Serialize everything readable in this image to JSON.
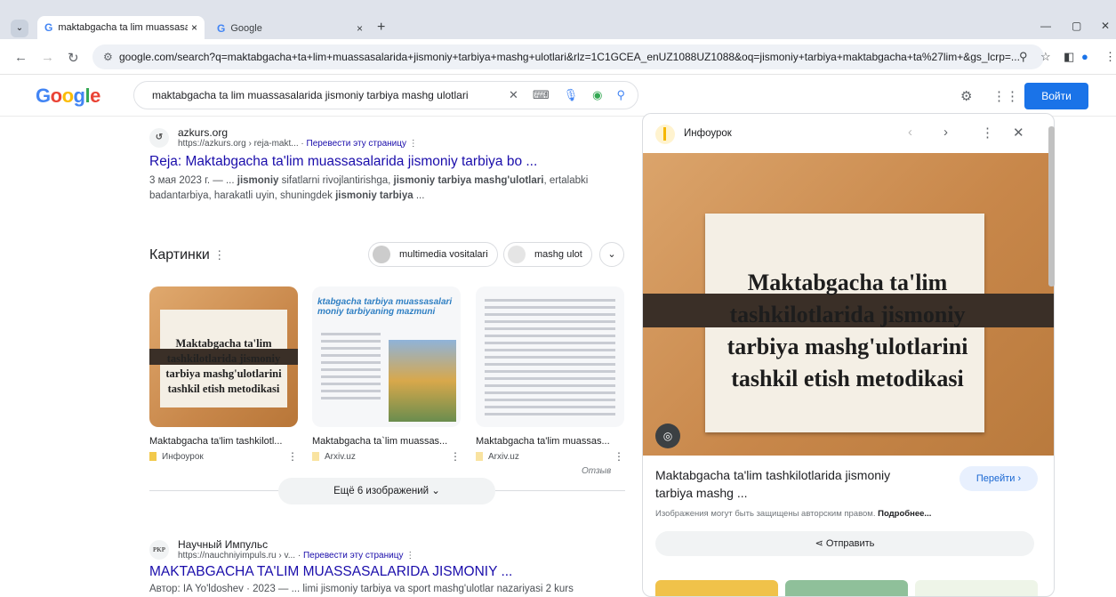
{
  "browser": {
    "tabs": [
      {
        "label": "maktabgacha ta lim muassasala",
        "close": "×"
      },
      {
        "label": "Google",
        "close": "×"
      }
    ],
    "new_tab": "+",
    "window_controls": {
      "minimize": "—",
      "restore": "▢",
      "close": "✕"
    },
    "url": "google.com/search?q=maktabgacha+ta+lim+muassasalarida+jismoniy+tarbiya+mashg+ulotlari&rlz=1C1GCEA_enUZ1088UZ1088&oq=jismoniy+tarbiya+maktabgacha+ta%27lim+&gs_lcrp=..."
  },
  "google": {
    "logo": "Google",
    "query": "maktabgacha ta lim muassasalarida jismoniy tarbiya mashg ulotlari",
    "login_label": "Войти"
  },
  "result1": {
    "site": "azkurs.org",
    "url": "https://azkurs.org › reja-makt...",
    "translate": "Перевести эту страницу",
    "title": "Reja: Maktabgacha ta'lim muassasalarida jismoniy tarbiya bo ...",
    "snippet_date": "3 мая 2023 г. — ...",
    "snippet_bold1": "jismoniy",
    "snippet_t1": "sifatlarni rivojlantirishga,",
    "snippet_bold2": "jismoniy tarbiya mashg'ulotlari",
    "snippet_t2": ", ertalabki badantarbiya, harakatli uyin, shuningdek",
    "snippet_bold3": "jismoniy tarbiya",
    "snippet_t3": "..."
  },
  "images": {
    "heading": "Картинки",
    "chips": [
      "multimedia vositalari",
      "mashg ulot"
    ],
    "cards": [
      {
        "caption": "Maktabgacha ta'lim tashkilotl...",
        "source": "Инфоурок",
        "img_text": "Maktabgacha ta'lim tashkilotlarida jismoniy tarbiya mashg'ulotlarini tashkil etish metodikasi"
      },
      {
        "caption": "Maktabgacha ta`lim muassas...",
        "source": "Arxiv.uz",
        "img_text": "ktabgacha tarbiya muassasalari moniy tarbiyaning mazmuni"
      },
      {
        "caption": "Maktabgacha ta'lim muassas...",
        "source": "Arxiv.uz"
      }
    ],
    "feedback": "Отзыв",
    "more_label": "Ещё 6 изображений"
  },
  "result2": {
    "site": "Научный Импульс",
    "favicon_text": "PKP",
    "url": "https://nauchniyimpuls.ru › v...",
    "translate": "Перевести эту страницу",
    "title": "MAKTABGACHA TA'LIM MUASSASALARIDA JISMONIY ...",
    "snippet": "Автор: IA Yo'ldoshev · 2023 — ... limi jismoniy tarbiya va sport mashg'ulotlar nazariyasi 2 kurs"
  },
  "panel": {
    "source": "Инфоурок",
    "img_text": "Maktabgacha ta'lim tashkilotlarida jismoniy tarbiya mashg'ulotlarini tashkil etish metodikasi",
    "title": "Maktabgacha ta'lim tashkilotlarida jismoniy tarbiya mashg ...",
    "go_label": "Перейти ›",
    "copyright": "Изображения могут быть защищены авторским правом.",
    "more": "Подробнее...",
    "share_label": "Отправить"
  }
}
